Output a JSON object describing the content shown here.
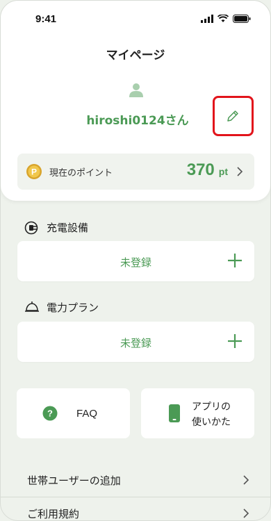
{
  "status_bar": {
    "time": "9:41"
  },
  "header": {
    "title": "マイページ"
  },
  "profile": {
    "username": "hiroshi0124さん"
  },
  "points": {
    "label": "現在のポイント",
    "value": "370",
    "unit": "pt"
  },
  "charging_equipment": {
    "title": "充電設備",
    "status": "未登録"
  },
  "power_plan": {
    "title": "電力プラン",
    "status": "未登録"
  },
  "tiles": {
    "faq": "FAQ",
    "guide_line1": "アプリの",
    "guide_line2": "使いかた"
  },
  "menu": [
    {
      "label": "世帯ユーザーの追加"
    },
    {
      "label": "ご利用規約"
    }
  ],
  "colors": {
    "accent": "#4b9a55",
    "highlight": "#e2141b",
    "background": "#eef2ec"
  }
}
